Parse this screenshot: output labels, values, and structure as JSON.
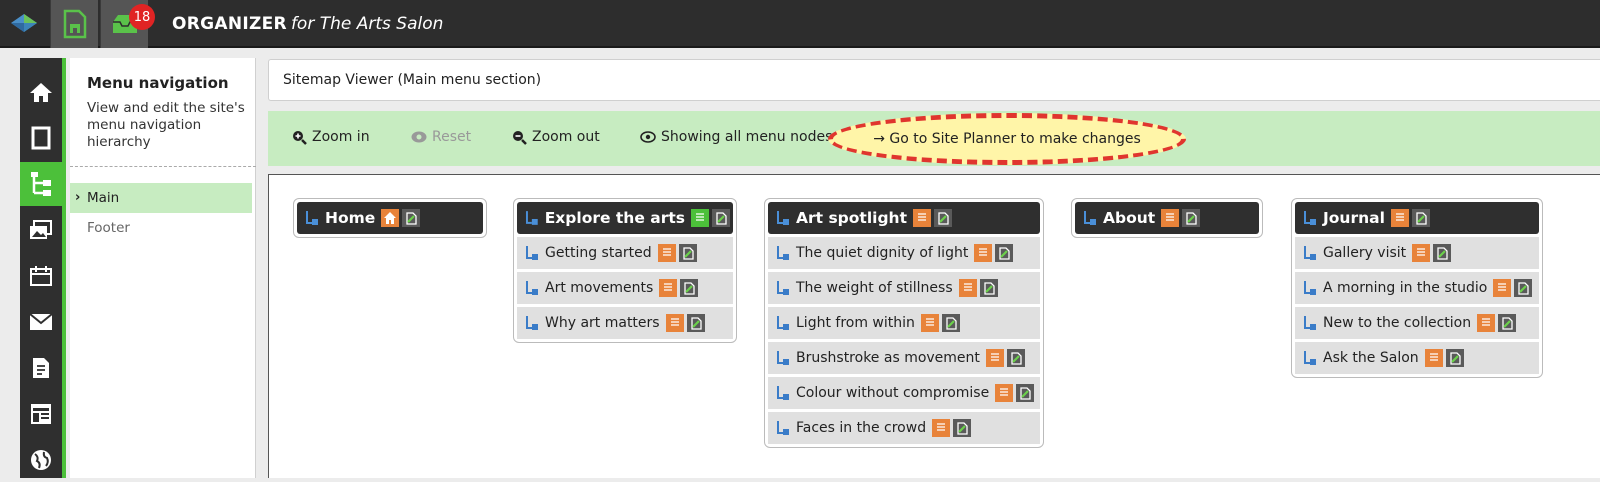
{
  "app": {
    "title_bold": "ORGANIZER",
    "title_italic": "for The Arts Salon",
    "notification_count": "18"
  },
  "colors": {
    "accent_green": "#4cc03a",
    "toolbar_green": "#c7ecc1",
    "header_dark": "#2d2d2d",
    "page_icon_orange": "#e8833a",
    "highlight_red": "#e0352e",
    "highlight_yellow": "#fff5a8"
  },
  "rail": {
    "items": [
      "home-icon",
      "page-icon",
      "sitemap-icon",
      "media-icon",
      "calendar-icon",
      "mail-icon",
      "forms-icon",
      "layout-icon",
      "globe-icon"
    ],
    "active": "sitemap-icon"
  },
  "nav": {
    "title": "Menu navigation",
    "description": "View and edit the site's menu navigation hierarchy",
    "items": [
      {
        "label": "Main",
        "selected": true
      },
      {
        "label": "Footer",
        "selected": false
      }
    ]
  },
  "main": {
    "header": "Sitemap Viewer (Main menu section)",
    "toolbar": {
      "zoom_in": "Zoom in",
      "reset": "Reset",
      "zoom_out": "Zoom out",
      "showing": "Showing all menu nodes",
      "planner": "→ Go to Site Planner to make changes"
    }
  },
  "sitemap": {
    "columns": [
      {
        "title": "Home",
        "icon": "home-page-icon",
        "items": []
      },
      {
        "title": "Explore the arts",
        "icon": "green-page-icon",
        "items": [
          "Getting started",
          "Art movements",
          "Why art matters"
        ]
      },
      {
        "title": "Art spotlight",
        "icon": "page-icon",
        "items": [
          "The quiet dignity of light",
          "The weight of stillness",
          "Light from within",
          "Brushstroke as movement",
          "Colour without compromise",
          "Faces in the crowd"
        ]
      },
      {
        "title": "About",
        "icon": "page-icon",
        "items": []
      },
      {
        "title": "Journal",
        "icon": "page-icon",
        "items": [
          "Gallery visit",
          "A morning in the studio",
          "New to the collection",
          "Ask the Salon"
        ]
      }
    ]
  }
}
